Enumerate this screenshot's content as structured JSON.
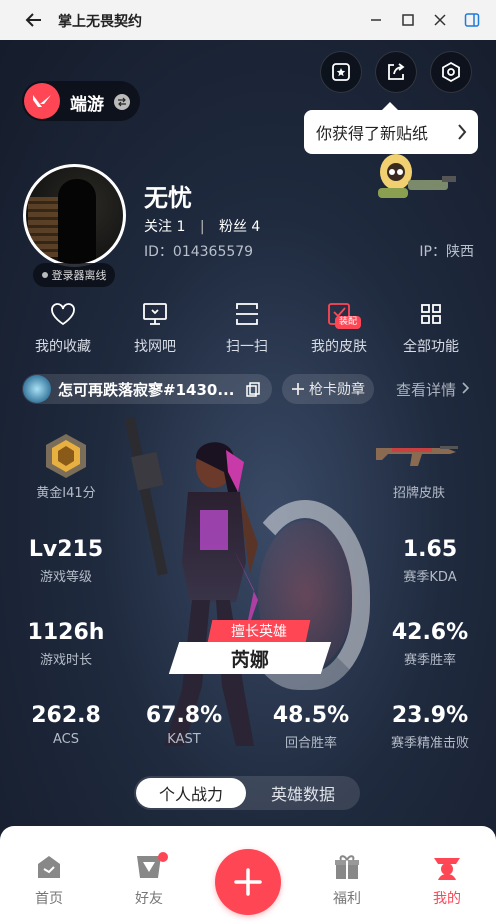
{
  "window": {
    "title": "掌上无畏契约"
  },
  "game": {
    "label": "端游"
  },
  "sticker_tip": {
    "text": "你获得了新贴纸"
  },
  "profile": {
    "nickname": "无忧",
    "follow_label": "关注 1",
    "fans_label": "粉丝 4",
    "separator": "|",
    "uid": "ID：014365579",
    "ip": "IP：陕西",
    "status": "登录器离线"
  },
  "functions": [
    {
      "label": "我的收藏",
      "icon": "heart-icon"
    },
    {
      "label": "找网吧",
      "icon": "monitor-icon"
    },
    {
      "label": "扫一扫",
      "icon": "scan-icon"
    },
    {
      "label": "我的皮肤",
      "icon": "skin-icon",
      "badge": "装配"
    },
    {
      "label": "全部功能",
      "icon": "grid-icon"
    }
  ],
  "account": {
    "name": "怎可再跌落寂寥#1430...",
    "medal_label": "枪卡勋章",
    "detail_label": "查看详情"
  },
  "stats": {
    "rank": {
      "label": "黄金Ⅰ41分"
    },
    "skin": {
      "label": "招牌皮肤"
    },
    "level": {
      "value": "Lv215",
      "label": "游戏等级"
    },
    "kda": {
      "value": "1.65",
      "label": "赛季KDA"
    },
    "duration": {
      "value": "1126h",
      "label": "游戏时长"
    },
    "winrate": {
      "value": "42.6%",
      "label": "赛季胜率"
    },
    "acs": {
      "value": "262.8",
      "label": "ACS"
    },
    "kast": {
      "value": "67.8%",
      "label": "KAST"
    },
    "round_win": {
      "value": "48.5%",
      "label": "回合胜率"
    },
    "headshot": {
      "value": "23.9%",
      "label": "赛季精准击败"
    }
  },
  "hero": {
    "tag": "擅长英雄",
    "name": "芮娜"
  },
  "segment": {
    "active": "个人战力",
    "other": "英雄数据"
  },
  "nav": [
    {
      "label": "首页",
      "icon": "home-icon"
    },
    {
      "label": "好友",
      "icon": "friends-icon",
      "has_dot": true
    },
    {
      "label": "福利",
      "icon": "gift-icon"
    },
    {
      "label": "我的",
      "icon": "profile-icon",
      "active": true
    }
  ],
  "colors": {
    "accent": "#ff4655",
    "background": "#1f2a3e"
  }
}
